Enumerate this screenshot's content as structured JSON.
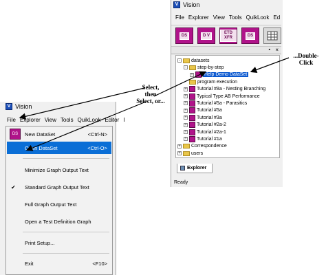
{
  "right_window": {
    "title": "Vision",
    "menu": [
      "File",
      "Explorer",
      "View",
      "Tools",
      "QuikLook",
      "Ed"
    ],
    "toolbar": [
      {
        "label": "DS",
        "icon": "dataset-icon"
      },
      {
        "label": "D V",
        "icon": "dataset-view-icon"
      },
      {
        "label": "ETD XFR",
        "icon": "etd-xfr-icon"
      },
      {
        "label": "DS",
        "icon": "dataset-icon"
      },
      {
        "label": "",
        "icon": "grid-icon"
      }
    ],
    "panel_close": "×",
    "tree": [
      {
        "label": "datasets",
        "type": "folder",
        "depth": 0,
        "expand": "-"
      },
      {
        "label": "step-by-step",
        "type": "folder",
        "depth": 1,
        "expand": "-"
      },
      {
        "label": "Help Demo DataSet",
        "type": "dataset",
        "depth": 2,
        "expand": "+",
        "selected": true
      },
      {
        "label": "program execution",
        "type": "folder",
        "depth": 1,
        "expand": ""
      },
      {
        "label": "Tutorial #8a - Nesting Branching",
        "type": "dataset",
        "depth": 1,
        "expand": "+"
      },
      {
        "label": "Typical Type AB Performance",
        "type": "dataset",
        "depth": 1,
        "expand": "+"
      },
      {
        "label": "Tutorial #5a - Parasitics",
        "type": "dataset",
        "depth": 1,
        "expand": "+"
      },
      {
        "label": "Tutorial #5a",
        "type": "dataset",
        "depth": 1,
        "expand": "+"
      },
      {
        "label": "Tutorial #3a",
        "type": "dataset",
        "depth": 1,
        "expand": "+"
      },
      {
        "label": "Tutorial #2a-2",
        "type": "dataset",
        "depth": 1,
        "expand": "+"
      },
      {
        "label": "Tutorial #2a-1",
        "type": "dataset",
        "depth": 1,
        "expand": "+"
      },
      {
        "label": "Tutorial #1a",
        "type": "dataset",
        "depth": 1,
        "expand": "+"
      },
      {
        "label": "Correspondence",
        "type": "folder",
        "depth": 0,
        "expand": "+"
      },
      {
        "label": "users",
        "type": "folder",
        "depth": 0,
        "expand": "+"
      }
    ],
    "tab": "Explorer",
    "status": "Ready"
  },
  "left_window": {
    "title": "Vision",
    "menu": [
      "File",
      "Explorer",
      "View",
      "Tools",
      "QuikLook",
      "Editor",
      "I"
    ],
    "file_menu": [
      {
        "label": "New DataSet",
        "shortcut": "<Ctrl-N>",
        "icon": "new-dataset-icon",
        "icon_text": "DS"
      },
      {
        "label": "Open DataSet",
        "shortcut": "<Ctrl-O>",
        "highlighted": true
      },
      {
        "label": "Minimize Graph Output Text",
        "shortcut": ""
      },
      {
        "label": "Standard Graph Output Text",
        "shortcut": "",
        "checked": true
      },
      {
        "label": "Full Graph Output Text",
        "shortcut": ""
      },
      {
        "label": "Open a Test Definition Graph",
        "shortcut": ""
      },
      {
        "label": "Print Setup...",
        "shortcut": ""
      },
      {
        "label": "Exit",
        "shortcut": "<F10>"
      }
    ]
  },
  "annotations": {
    "select": [
      "Select,",
      "then",
      "Select, or..."
    ],
    "double_click": [
      "...Double-",
      "Click"
    ]
  },
  "colors": {
    "highlight": "#0a6ed6",
    "tree_selection": "#0a58d0",
    "dataset_icon": "#b0138a",
    "folder": "#e9c64a",
    "arrow": "#000000"
  }
}
